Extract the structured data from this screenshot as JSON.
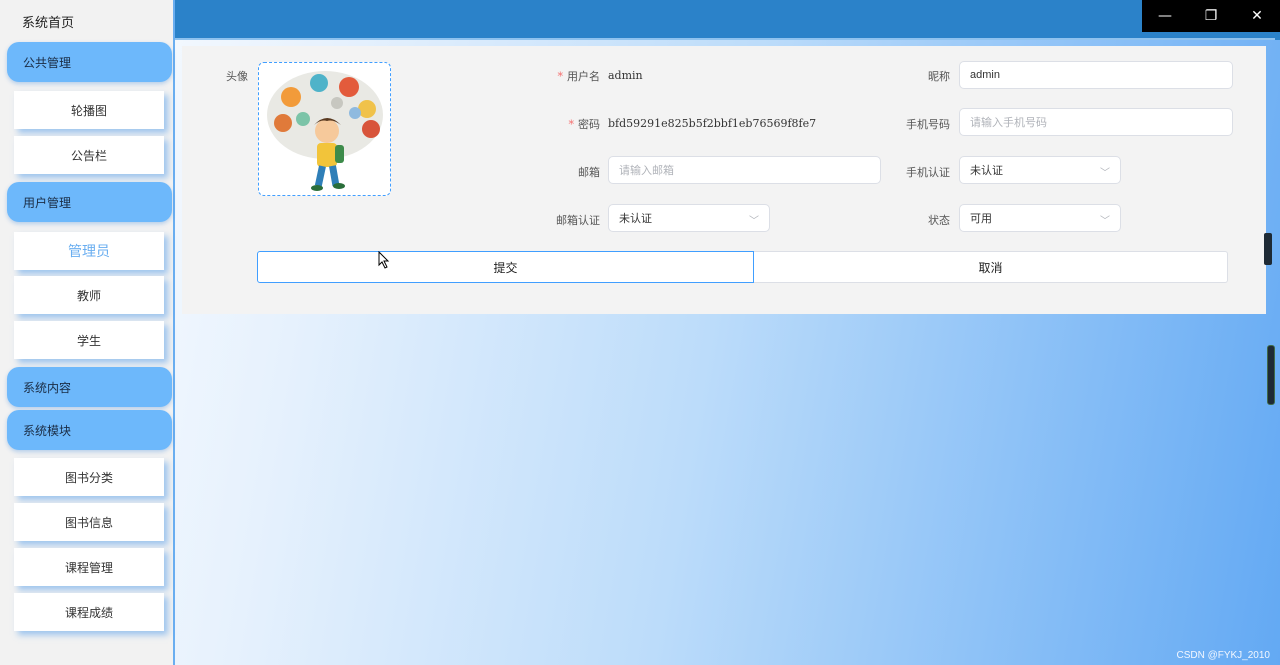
{
  "sidebar": {
    "home": "系统首页",
    "groups": {
      "public": "公共管理",
      "user": "用户管理",
      "content": "系统内容",
      "module": "系统模块"
    },
    "items": {
      "carousel": "轮播图",
      "notice": "公告栏",
      "admin": "管理员",
      "teacher": "教师",
      "student": "学生",
      "book_category": "图书分类",
      "book_info": "图书信息",
      "course_mgmt": "课程管理",
      "course_score": "课程成绩"
    }
  },
  "window": {
    "minimize": "—",
    "restore": "❐",
    "close": "✕"
  },
  "form": {
    "avatar_label": "头像",
    "username_label": "用户名",
    "username_value": "admin",
    "nickname_label": "昵称",
    "nickname_value": "admin",
    "password_label": "密码",
    "password_value": "bfd59291e825b5f2bbf1eb76569f8fe7",
    "phone_label": "手机号码",
    "phone_placeholder": "请输入手机号码",
    "email_label": "邮箱",
    "email_placeholder": "请输入邮箱",
    "phone_verify_label": "手机认证",
    "phone_verify_value": "未认证",
    "email_verify_label": "邮箱认证",
    "email_verify_value": "未认证",
    "status_label": "状态",
    "status_value": "可用",
    "submit": "提交",
    "cancel": "取消"
  },
  "watermark": "CSDN @FYKJ_2010",
  "colors": {
    "accent": "#409eff",
    "sidebar_group": "#6db8fb",
    "topbar": "#2b82c9",
    "required": "#f56c6c"
  }
}
